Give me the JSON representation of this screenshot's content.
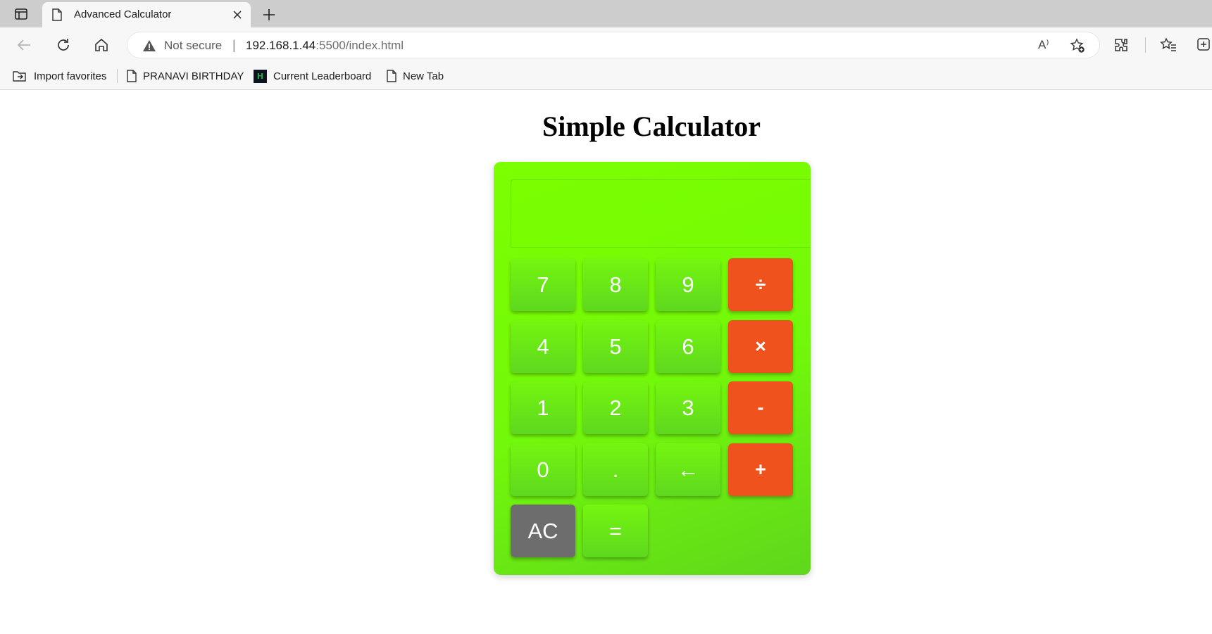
{
  "browser": {
    "tab": {
      "title": "Advanced Calculator"
    },
    "address_bar": {
      "security_label": "Not secure",
      "separator": "|",
      "url_host": "192.168.1.44",
      "url_rest": ":5500/index.html",
      "read_aloud_glyph": "A⁾"
    },
    "bookmarks": [
      {
        "label": "Import favorites"
      },
      {
        "label": "PRANAVI BIRTHDAY"
      },
      {
        "label": "Current Leaderboard",
        "logo_text": "H"
      },
      {
        "label": "New Tab"
      }
    ]
  },
  "page": {
    "title": "Simple Calculator"
  },
  "calculator": {
    "display_value": "",
    "keys": {
      "seven": "7",
      "eight": "8",
      "nine": "9",
      "divide": "÷",
      "four": "4",
      "five": "5",
      "six": "6",
      "multiply": "×",
      "one": "1",
      "two": "2",
      "three": "3",
      "subtract": "-",
      "zero": "0",
      "decimal": ".",
      "backspace": "←",
      "add": "+",
      "clear": "AC",
      "equals": "="
    },
    "colors": {
      "body": "#7cff00",
      "digit_key": "#6ae812",
      "operator_key": "#f0521e",
      "clear_key": "#6d6d6d"
    }
  }
}
